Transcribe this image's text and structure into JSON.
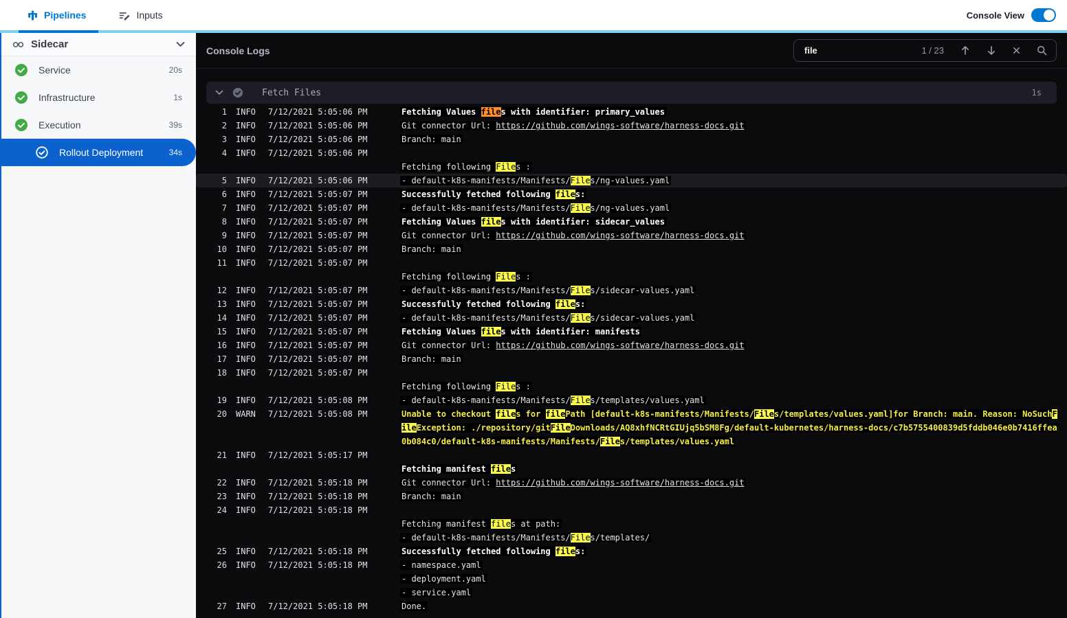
{
  "topbar": {
    "tabs": [
      {
        "label": "Pipelines",
        "icon": "pipelines-icon",
        "active": true
      },
      {
        "label": "Inputs",
        "icon": "inputs-icon",
        "active": false
      }
    ],
    "console_view_label": "Console View",
    "console_view_on": true
  },
  "colors": {
    "accent_blue": "#0278d5",
    "accent_cyan": "#7ed0ef",
    "selected_step_blue": "#0b62cd",
    "success_green": "#42ab45",
    "match_highlight": "#fcfc4e",
    "current_match_highlight": "#ff8f2e",
    "warn_text": "#f3ec44",
    "console_bg": "#0b0b0e"
  },
  "sidebar": {
    "title": "Sidecar",
    "title_icon": "link-icon",
    "items": [
      {
        "label": "Service",
        "duration": "20s",
        "status": "success",
        "selected": false,
        "indent": false
      },
      {
        "label": "Infrastructure",
        "duration": "1s",
        "status": "success",
        "selected": false,
        "indent": false
      },
      {
        "label": "Execution",
        "duration": "39s",
        "status": "success",
        "selected": false,
        "indent": false
      },
      {
        "label": "Rollout Deployment",
        "duration": "34s",
        "status": "success",
        "selected": true,
        "indent": true
      }
    ]
  },
  "console": {
    "title": "Console Logs",
    "search": {
      "value": "file",
      "counter": "1 / 23",
      "icons": [
        "arrow-up-icon",
        "arrow-down-icon",
        "close-icon",
        "search-icon"
      ]
    },
    "section": {
      "title": "Fetch Files",
      "duration": "1s",
      "icons": [
        "chevron-down-icon",
        "check-circle-icon"
      ]
    },
    "lines": [
      {
        "n": 1,
        "level": "INFO",
        "time": "7/12/2021 5:05:06 PM",
        "rows": [
          [
            {
              "t": "Fetching Values files with identifier: primary_values",
              "b": true
            }
          ]
        ]
      },
      {
        "n": 2,
        "level": "INFO",
        "time": "7/12/2021 5:05:06 PM",
        "rows": [
          [
            {
              "t": "Git connector Url: "
            },
            {
              "t": "https://github.com/wings-software/harness-docs.git",
              "link": true
            }
          ]
        ]
      },
      {
        "n": 3,
        "level": "INFO",
        "time": "7/12/2021 5:05:06 PM",
        "rows": [
          [
            {
              "t": "Branch: main"
            }
          ]
        ]
      },
      {
        "n": 4,
        "level": "INFO",
        "time": "7/12/2021 5:05:06 PM",
        "rows": [
          [],
          [
            {
              "t": "Fetching following Files :"
            }
          ]
        ]
      },
      {
        "n": 5,
        "level": "INFO",
        "time": "7/12/2021 5:05:06 PM",
        "selected": true,
        "rows": [
          [
            {
              "t": "- default-k8s-manifests/Manifests/Files/ng-values.yaml"
            }
          ]
        ]
      },
      {
        "n": 6,
        "level": "INFO",
        "time": "7/12/2021 5:05:07 PM",
        "rows": [
          [
            {
              "t": "Successfully fetched following files:",
              "b": true
            }
          ]
        ]
      },
      {
        "n": 7,
        "level": "INFO",
        "time": "7/12/2021 5:05:07 PM",
        "rows": [
          [
            {
              "t": "- default-k8s-manifests/Manifests/Files/ng-values.yaml"
            }
          ]
        ]
      },
      {
        "n": 8,
        "level": "INFO",
        "time": "7/12/2021 5:05:07 PM",
        "rows": [
          [
            {
              "t": "Fetching Values files with identifier: sidecar_values",
              "b": true
            }
          ]
        ]
      },
      {
        "n": 9,
        "level": "INFO",
        "time": "7/12/2021 5:05:07 PM",
        "rows": [
          [
            {
              "t": "Git connector Url: "
            },
            {
              "t": "https://github.com/wings-software/harness-docs.git",
              "link": true
            }
          ]
        ]
      },
      {
        "n": 10,
        "level": "INFO",
        "time": "7/12/2021 5:05:07 PM",
        "rows": [
          [
            {
              "t": "Branch: main"
            }
          ]
        ]
      },
      {
        "n": 11,
        "level": "INFO",
        "time": "7/12/2021 5:05:07 PM",
        "rows": [
          [],
          [
            {
              "t": "Fetching following Files :"
            }
          ]
        ]
      },
      {
        "n": 12,
        "level": "INFO",
        "time": "7/12/2021 5:05:07 PM",
        "rows": [
          [
            {
              "t": "- default-k8s-manifests/Manifests/Files/sidecar-values.yaml"
            }
          ]
        ]
      },
      {
        "n": 13,
        "level": "INFO",
        "time": "7/12/2021 5:05:07 PM",
        "rows": [
          [
            {
              "t": "Successfully fetched following files:",
              "b": true
            }
          ]
        ]
      },
      {
        "n": 14,
        "level": "INFO",
        "time": "7/12/2021 5:05:07 PM",
        "rows": [
          [
            {
              "t": "- default-k8s-manifests/Manifests/Files/sidecar-values.yaml"
            }
          ]
        ]
      },
      {
        "n": 15,
        "level": "INFO",
        "time": "7/12/2021 5:05:07 PM",
        "rows": [
          [
            {
              "t": "Fetching Values files with identifier: manifests",
              "b": true
            }
          ]
        ]
      },
      {
        "n": 16,
        "level": "INFO",
        "time": "7/12/2021 5:05:07 PM",
        "rows": [
          [
            {
              "t": "Git connector Url: "
            },
            {
              "t": "https://github.com/wings-software/harness-docs.git",
              "link": true
            }
          ]
        ]
      },
      {
        "n": 17,
        "level": "INFO",
        "time": "7/12/2021 5:05:07 PM",
        "rows": [
          [
            {
              "t": "Branch: main"
            }
          ]
        ]
      },
      {
        "n": 18,
        "level": "INFO",
        "time": "7/12/2021 5:05:07 PM",
        "rows": [
          [],
          [
            {
              "t": "Fetching following Files :"
            }
          ]
        ]
      },
      {
        "n": 19,
        "level": "INFO",
        "time": "7/12/2021 5:05:08 PM",
        "rows": [
          [
            {
              "t": "- default-k8s-manifests/Manifests/Files/templates/values.yaml"
            }
          ]
        ]
      },
      {
        "n": 20,
        "level": "WARN",
        "time": "7/12/2021 5:05:08 PM",
        "rows": [
          [
            {
              "t": "Unable to checkout files for filePath [default-k8s-manifests/Manifests/Files/templates/values.yaml]for Branch: main. Reason: NoSuchFileException: ./repository/gitFileDownloads/AQ8xhfNCRtGIUjq5bSM8Fg/default-kubernetes/harness-docs/c7b5755400839d5fddb046e0b7416ffea0b084c0/default-k8s-manifests/Manifests/Files/templates/values.yaml",
              "b": true
            }
          ]
        ]
      },
      {
        "n": 21,
        "level": "INFO",
        "time": "7/12/2021 5:05:17 PM",
        "rows": [
          [],
          [
            {
              "t": "Fetching manifest files",
              "b": true
            }
          ]
        ]
      },
      {
        "n": 22,
        "level": "INFO",
        "time": "7/12/2021 5:05:18 PM",
        "rows": [
          [
            {
              "t": "Git connector Url: "
            },
            {
              "t": "https://github.com/wings-software/harness-docs.git",
              "link": true
            }
          ]
        ]
      },
      {
        "n": 23,
        "level": "INFO",
        "time": "7/12/2021 5:05:18 PM",
        "rows": [
          [
            {
              "t": "Branch: main"
            }
          ]
        ]
      },
      {
        "n": 24,
        "level": "INFO",
        "time": "7/12/2021 5:05:18 PM",
        "rows": [
          [],
          [
            {
              "t": "Fetching manifest files at path:"
            }
          ],
          [
            {
              "t": "- default-k8s-manifests/Manifests/Files/templates/"
            }
          ]
        ]
      },
      {
        "n": 25,
        "level": "INFO",
        "time": "7/12/2021 5:05:18 PM",
        "rows": [
          [
            {
              "t": "Successfully fetched following files:",
              "b": true
            }
          ]
        ]
      },
      {
        "n": 26,
        "level": "INFO",
        "time": "7/12/2021 5:05:18 PM",
        "rows": [
          [
            {
              "t": "- namespace.yaml"
            }
          ],
          [
            {
              "t": "- deployment.yaml"
            }
          ],
          [
            {
              "t": "- service.yaml"
            }
          ]
        ]
      },
      {
        "n": 27,
        "level": "INFO",
        "time": "7/12/2021 5:05:18 PM",
        "rows": [
          [
            {
              "t": "Done."
            }
          ]
        ]
      }
    ]
  }
}
